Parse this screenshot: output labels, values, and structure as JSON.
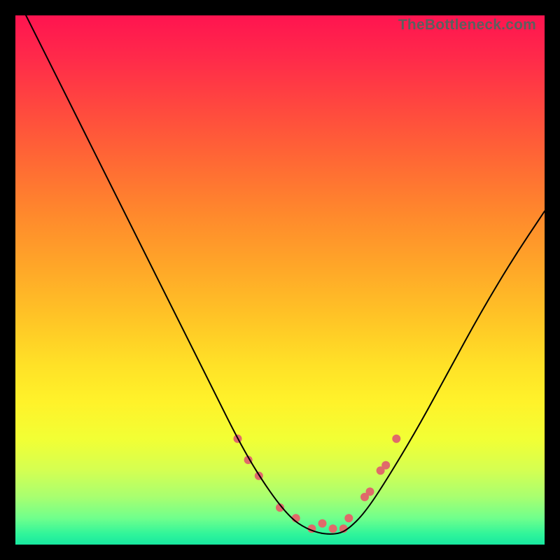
{
  "attribution": "TheBottleneck.com",
  "chart_data": {
    "type": "line",
    "title": "",
    "xlabel": "",
    "ylabel": "",
    "xlim": [
      0,
      100
    ],
    "ylim": [
      0,
      100
    ],
    "grid": false,
    "legend": false,
    "series": [
      {
        "name": "curve",
        "color": "#000000",
        "x": [
          2,
          6,
          11,
          17,
          23,
          30,
          37,
          43,
          48,
          52,
          55,
          58,
          61,
          63,
          66,
          70,
          76,
          82,
          88,
          94,
          100
        ],
        "y": [
          100,
          92,
          82,
          70,
          58,
          44,
          30,
          18,
          10,
          5,
          3,
          2,
          2,
          3,
          6,
          12,
          22,
          33,
          44,
          54,
          63
        ]
      }
    ],
    "markers": {
      "name": "highlight-dots",
      "color": "#e06a6a",
      "radius_px": 6,
      "x": [
        42,
        44,
        46,
        50,
        53,
        56,
        58,
        60,
        62,
        63,
        66,
        67,
        69,
        70,
        72
      ],
      "y": [
        20,
        16,
        13,
        7,
        5,
        3,
        4,
        3,
        3,
        5,
        9,
        10,
        14,
        15,
        20
      ]
    },
    "background_gradient_stops": [
      {
        "pos": 0.0,
        "color": "#ff1450"
      },
      {
        "pos": 0.08,
        "color": "#ff2a4a"
      },
      {
        "pos": 0.18,
        "color": "#ff4a3e"
      },
      {
        "pos": 0.28,
        "color": "#ff6a34"
      },
      {
        "pos": 0.38,
        "color": "#ff8a2c"
      },
      {
        "pos": 0.48,
        "color": "#ffa828"
      },
      {
        "pos": 0.58,
        "color": "#ffc726"
      },
      {
        "pos": 0.66,
        "color": "#ffe127"
      },
      {
        "pos": 0.73,
        "color": "#fff22a"
      },
      {
        "pos": 0.8,
        "color": "#f2ff34"
      },
      {
        "pos": 0.86,
        "color": "#d4ff52"
      },
      {
        "pos": 0.91,
        "color": "#a8ff70"
      },
      {
        "pos": 0.95,
        "color": "#70ff8c"
      },
      {
        "pos": 0.98,
        "color": "#30f59a"
      },
      {
        "pos": 1.0,
        "color": "#18e8a0"
      }
    ]
  }
}
